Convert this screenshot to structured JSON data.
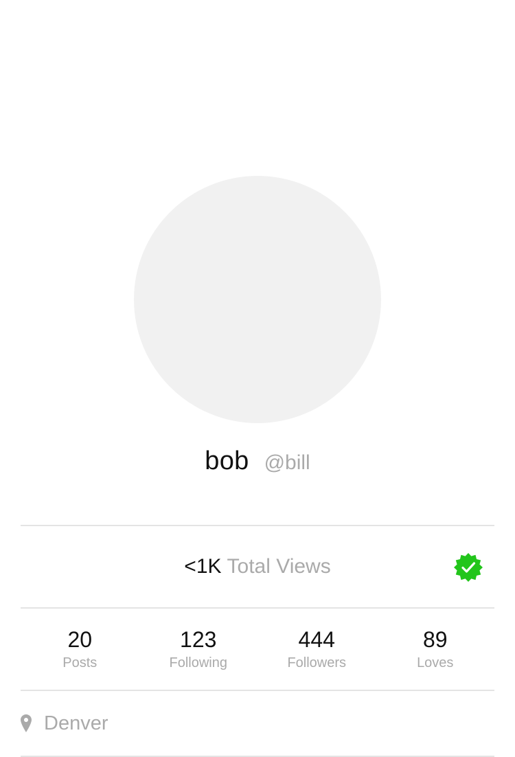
{
  "profile": {
    "display_name": "bob",
    "handle": "@bill"
  },
  "views": {
    "count": "<1K",
    "label": "Total Views",
    "verified_icon": "verified-badge-icon",
    "verified_color": "#22c51b"
  },
  "stats": [
    {
      "value": "20",
      "label": "Posts"
    },
    {
      "value": "123",
      "label": "Following"
    },
    {
      "value": "444",
      "label": "Followers"
    },
    {
      "value": "89",
      "label": "Loves"
    }
  ],
  "location": {
    "icon": "map-pin-icon",
    "text": "Denver"
  }
}
